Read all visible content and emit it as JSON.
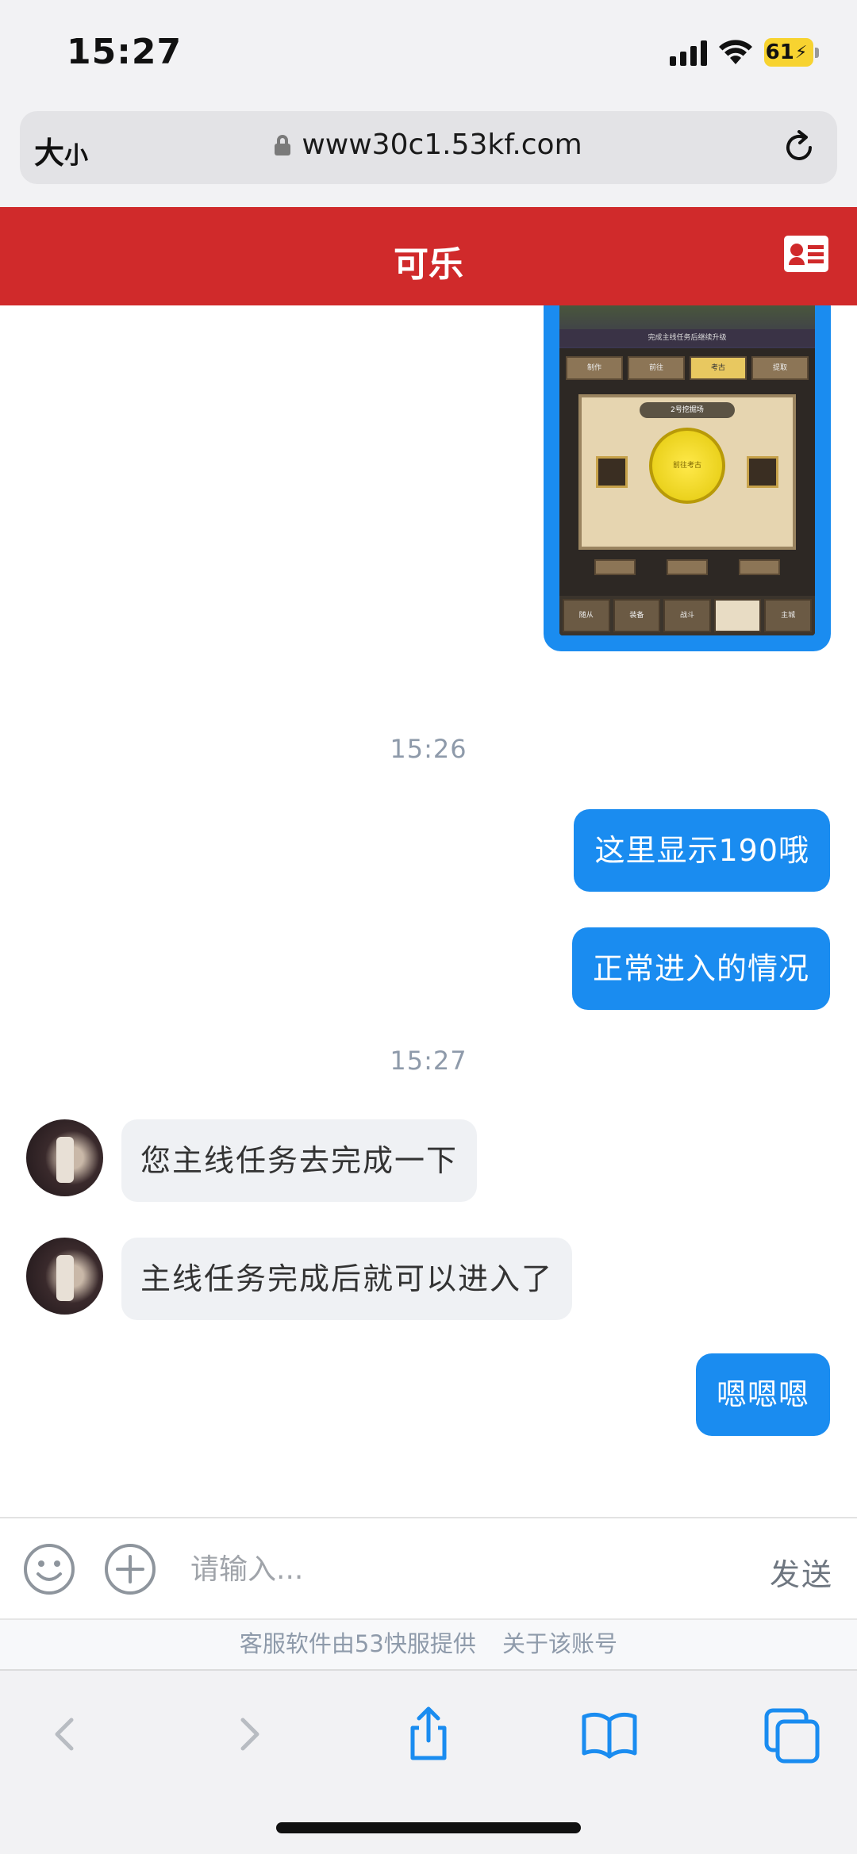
{
  "status_bar": {
    "time": "15:27",
    "battery": "61"
  },
  "url_bar": {
    "size_button_large": "大",
    "size_button_small": "小",
    "url": "www30c1.53kf.com"
  },
  "header": {
    "title": "可乐"
  },
  "shared_image": {
    "banner": "完成主线任务后继续升级",
    "tabs": [
      "制作",
      "前往",
      "考古",
      "提取"
    ],
    "panel_title": "2号挖掘场",
    "center_button": "前往考古",
    "bottom_tabs": [
      "随从",
      "装备",
      "战斗",
      "",
      "主城"
    ]
  },
  "messages": [
    {
      "type": "time",
      "text": "15:26"
    },
    {
      "type": "out",
      "text": "这里显示190哦"
    },
    {
      "type": "out",
      "text": "正常进入的情况"
    },
    {
      "type": "time",
      "text": "15:27"
    },
    {
      "type": "in",
      "text": "您主线任务去完成一下"
    },
    {
      "type": "in",
      "text": "主线任务完成后就可以进入了"
    },
    {
      "type": "out",
      "text": "嗯嗯嗯"
    }
  ],
  "input_bar": {
    "placeholder": "请输入...",
    "send_label": "发送"
  },
  "footer": {
    "provider": "客服软件由53快服提供",
    "about": "关于该账号"
  },
  "colors": {
    "header_red": "#d02a2b",
    "bubble_blue": "#1a8cf0",
    "incoming_bg": "#eff1f4"
  }
}
